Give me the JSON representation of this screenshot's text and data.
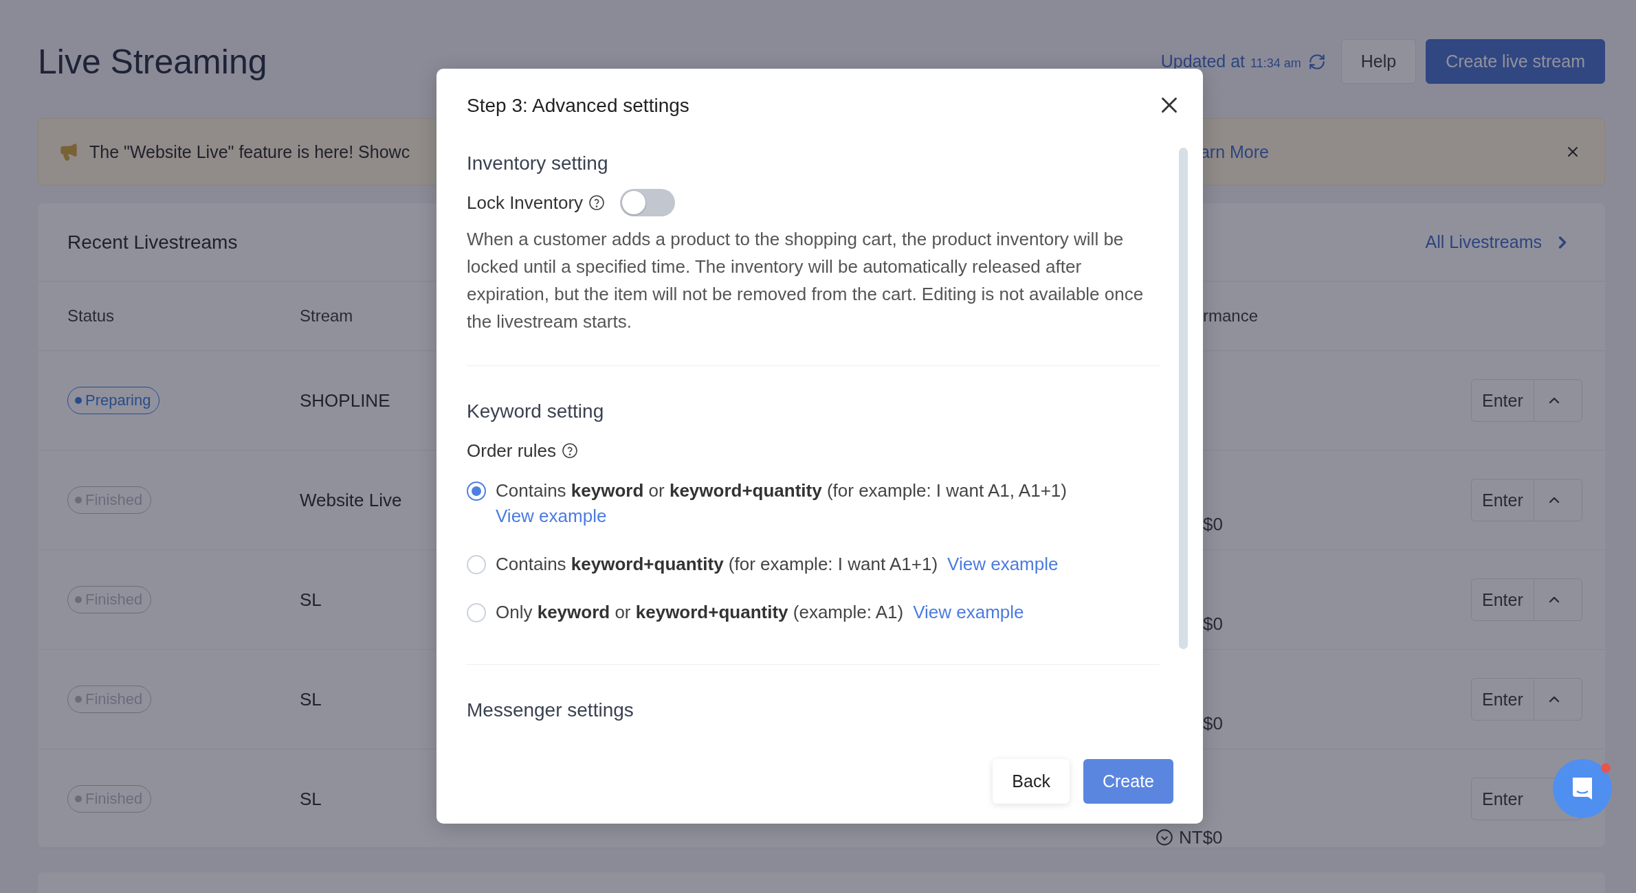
{
  "page": {
    "title": "Live Streaming",
    "updated_label": "Updated at",
    "updated_time": "11:34 am",
    "buttons": [
      {
        "label": "Help",
        "kind": "secondary"
      },
      {
        "label": "Create live stream",
        "kind": "primary"
      }
    ]
  },
  "banner": {
    "message": "The \"Website Live\" feature is here! Showc",
    "link": "arn More"
  },
  "recent": {
    "title": "Recent Livestreams",
    "link": "All Livestreams",
    "columns": [
      "Status",
      "Stream",
      "rmance"
    ],
    "rows": [
      {
        "status": "Preparing",
        "kind": "preparing",
        "stream": "SHOPLINE",
        "action": "Enter",
        "caret": true,
        "currency_icon": false
      },
      {
        "status": "Finished",
        "kind": "finished",
        "stream": "Website Live",
        "performance": "$0",
        "action": "Enter",
        "caret": true,
        "currency_icon": false
      },
      {
        "status": "Finished",
        "kind": "finished",
        "stream": "SL",
        "performance": "$0",
        "action": "Enter",
        "caret": true,
        "currency_icon": false
      },
      {
        "status": "Finished",
        "kind": "finished",
        "stream": "SL",
        "performance": "$0",
        "action": "Enter",
        "caret": true,
        "currency_icon": false
      },
      {
        "status": "Finished",
        "kind": "finished",
        "stream": "SL",
        "performance": "NT$0",
        "action": "Enter",
        "caret": false,
        "currency_icon": true
      }
    ]
  },
  "modal": {
    "title": "Step 3: Advanced settings",
    "sections": [
      {
        "kind": "toggle",
        "heading": "Inventory setting",
        "label": "Lock Inventory",
        "on": false,
        "description": "When a customer adds a product to the shopping cart, the product inventory will be locked until a specified time. The inventory will be automatically released after expiration, but the item will not be removed from the cart. Editing is not available once the livestream starts."
      },
      {
        "kind": "radios",
        "heading": "Keyword setting",
        "label": "Order rules",
        "options": [
          {
            "text": "Contains **keyword** or **keyword+quantity** (for example: I want A1, A1+1)",
            "link": "View example",
            "selected": true
          },
          {
            "text": "Contains **keyword+quantity** (for example: I want A1+1)",
            "link": "View example",
            "selected": false
          },
          {
            "text": "Only **keyword** or **keyword+quantity** (example: A1)",
            "link": "View example",
            "selected": false
          }
        ]
      },
      {
        "kind": "heading",
        "heading": "Messenger settings"
      }
    ],
    "buttons": [
      {
        "label": "Back",
        "kind": "secondary"
      },
      {
        "label": "Create",
        "kind": "primary"
      }
    ]
  },
  "chat": {
    "unread": true
  }
}
